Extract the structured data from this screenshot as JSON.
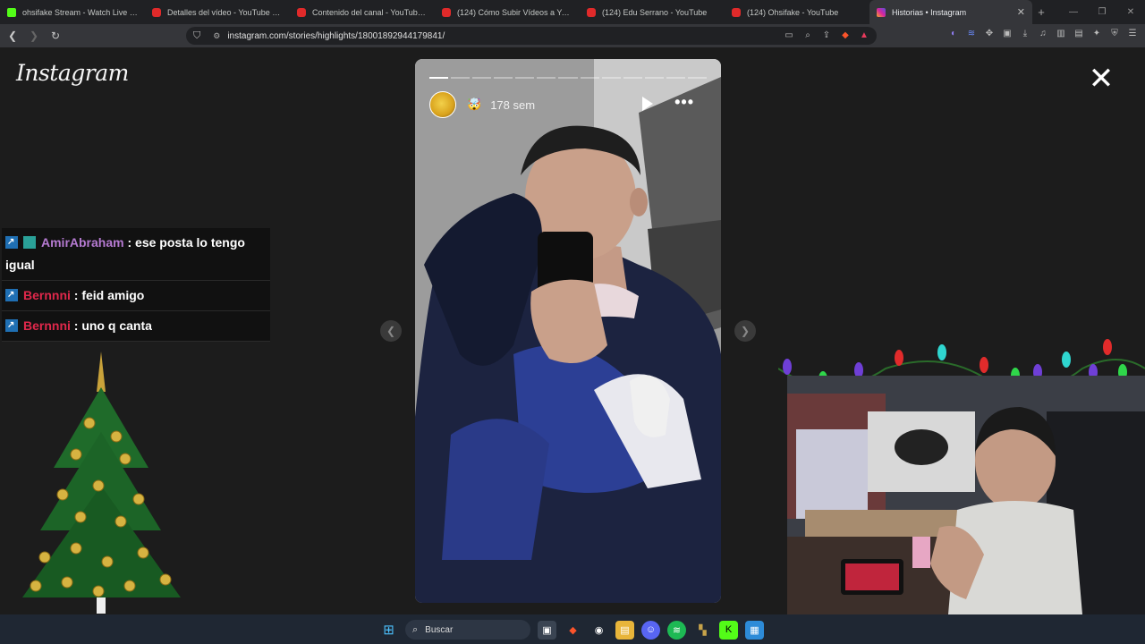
{
  "tabs": [
    {
      "title": "ohsifake Stream - Watch Live on",
      "color": "#53fc18"
    },
    {
      "title": "Detalles del vídeo - YouTube Studio",
      "color": "#e02a2a"
    },
    {
      "title": "Contenido del canal - YouTube Studi",
      "color": "#e02a2a"
    },
    {
      "title": "(124) Cómo Subir Vídeos a YouTube",
      "color": "#e02a2a"
    },
    {
      "title": "(124) Edu Serrano - YouTube",
      "color": "#e02a2a"
    },
    {
      "title": "(124) Ohsifake - YouTube",
      "color": "#e02a2a"
    },
    {
      "title": "Historias • Instagram",
      "color": "#d6249f",
      "active": true
    }
  ],
  "toolbar": {
    "url": "instagram.com/stories/highlights/18001892944179841/"
  },
  "page": {
    "logo": "Instagram"
  },
  "story": {
    "time_ago": "178 sem",
    "emoji": "🤯",
    "segments_total": 13,
    "segments_done": 1
  },
  "chat": [
    {
      "user": "AmirAbraham",
      "text": " : ese posta lo tengo igual"
    },
    {
      "user": "Bernnni",
      "text": " : feid amigo"
    },
    {
      "user": "Bernnni",
      "text": " : uno q canta"
    }
  ],
  "taskbar": {
    "search_label": "Buscar"
  },
  "colors": {
    "accent_kick": "#53fc18",
    "chat_user_purple": "#b57ad1",
    "chat_user_red": "#e0284b"
  }
}
